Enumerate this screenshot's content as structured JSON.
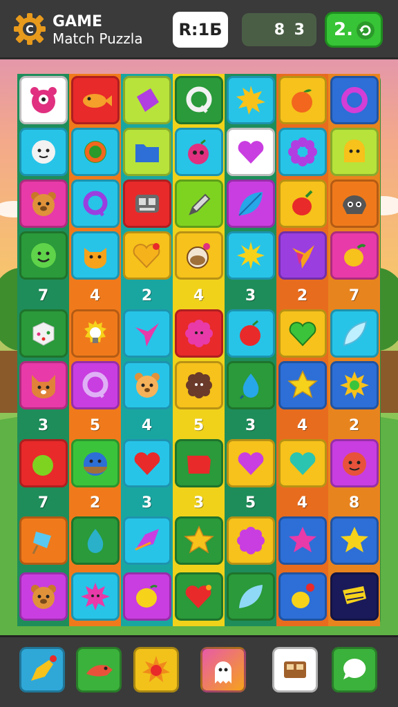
{
  "header": {
    "title": "GAME",
    "subtitle": "Match Puzzla",
    "round_label": "R:1Б",
    "score": "8 3",
    "moves": "2."
  },
  "colors": {
    "topbar": "#3a3a3a",
    "board": "#2f8f3a",
    "moves_button": "#37c436"
  },
  "board": {
    "column_counts": [
      [
        "7",
        "4",
        "2",
        "4",
        "3",
        "2",
        "7"
      ],
      [
        "3",
        "5",
        "4",
        "5",
        "3",
        "4",
        "2"
      ],
      [
        "7",
        "2",
        "3",
        "3",
        "5",
        "4",
        "8"
      ]
    ]
  },
  "powerups": [
    {
      "icon": "rocket-icon",
      "color": "#2fa8d8"
    },
    {
      "icon": "dragon-icon",
      "color": "#3bb23b"
    },
    {
      "icon": "sun-bomb-icon",
      "color": "#f2c21b"
    },
    {
      "icon": "ghost-booster-icon",
      "color": "#e85aa8"
    },
    {
      "icon": "box-icon",
      "color": "#ffffff"
    },
    {
      "icon": "chat-icon",
      "color": "#3bb23b"
    }
  ]
}
